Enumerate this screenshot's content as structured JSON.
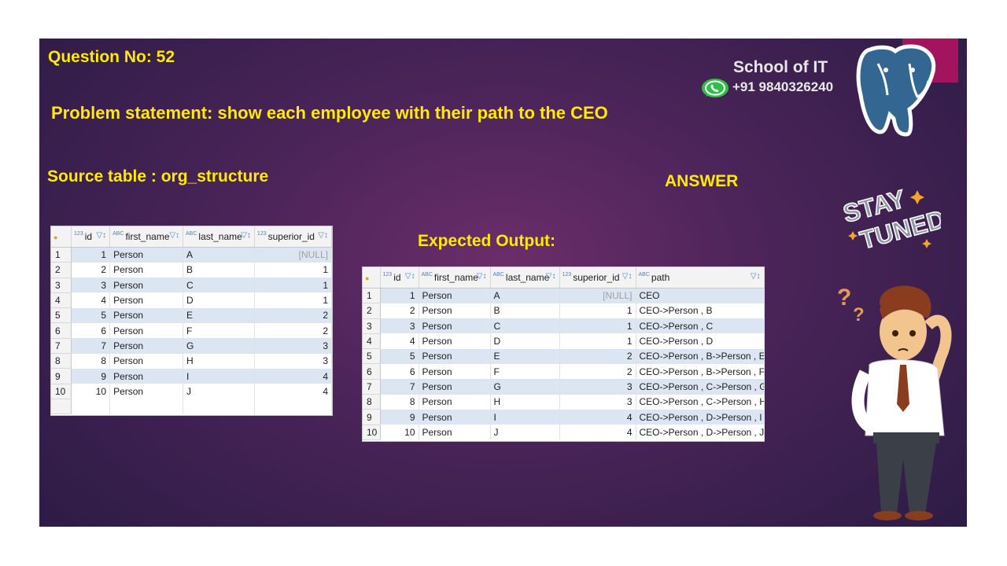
{
  "question": "Question No: 52",
  "problem": "Problem statement: show each employee with their path to the CEO",
  "source_label": "Source table : org_structure",
  "answer_label": "ANSWER",
  "expected_label": "Expected Output:",
  "brand": {
    "name": "School of IT",
    "phone": "+91 9840326240"
  },
  "sticker": {
    "line1": "STAY",
    "line2": "TUNED"
  },
  "source_table": {
    "columns": [
      {
        "type": "123",
        "name": "id"
      },
      {
        "type": "ABC",
        "name": "first_name"
      },
      {
        "type": "ABC",
        "name": "last_name"
      },
      {
        "type": "123",
        "name": "superior_id"
      }
    ],
    "rows": [
      [
        "1",
        "1",
        "Person",
        "A",
        "[NULL]"
      ],
      [
        "2",
        "2",
        "Person",
        "B",
        "1"
      ],
      [
        "3",
        "3",
        "Person",
        "C",
        "1"
      ],
      [
        "4",
        "4",
        "Person",
        "D",
        "1"
      ],
      [
        "5",
        "5",
        "Person",
        "E",
        "2"
      ],
      [
        "6",
        "6",
        "Person",
        "F",
        "2"
      ],
      [
        "7",
        "7",
        "Person",
        "G",
        "3"
      ],
      [
        "8",
        "8",
        "Person",
        "H",
        "3"
      ],
      [
        "9",
        "9",
        "Person",
        "I",
        "4"
      ],
      [
        "10",
        "10",
        "Person",
        "J",
        "4"
      ]
    ]
  },
  "output_table": {
    "columns": [
      {
        "type": "123",
        "name": "id"
      },
      {
        "type": "ABC",
        "name": "first_name"
      },
      {
        "type": "ABC",
        "name": "last_name"
      },
      {
        "type": "123",
        "name": "superior_id"
      },
      {
        "type": "ABC",
        "name": "path"
      }
    ],
    "rows": [
      [
        "1",
        "1",
        "Person",
        "A",
        "[NULL]",
        "CEO"
      ],
      [
        "2",
        "2",
        "Person",
        "B",
        "1",
        "CEO->Person , B"
      ],
      [
        "3",
        "3",
        "Person",
        "C",
        "1",
        "CEO->Person , C"
      ],
      [
        "4",
        "4",
        "Person",
        "D",
        "1",
        "CEO->Person , D"
      ],
      [
        "5",
        "5",
        "Person",
        "E",
        "2",
        "CEO->Person , B->Person , E"
      ],
      [
        "6",
        "6",
        "Person",
        "F",
        "2",
        "CEO->Person , B->Person , F"
      ],
      [
        "7",
        "7",
        "Person",
        "G",
        "3",
        "CEO->Person , C->Person , G"
      ],
      [
        "8",
        "8",
        "Person",
        "H",
        "3",
        "CEO->Person , C->Person , H"
      ],
      [
        "9",
        "9",
        "Person",
        "I",
        "4",
        "CEO->Person , D->Person , I"
      ],
      [
        "10",
        "10",
        "Person",
        "J",
        "4",
        "CEO->Person , D->Person , J"
      ]
    ]
  },
  "colors": {
    "accent_yellow": "#ffea00",
    "slide_bg": "#4a2458",
    "brand_pink": "#a3145e"
  }
}
